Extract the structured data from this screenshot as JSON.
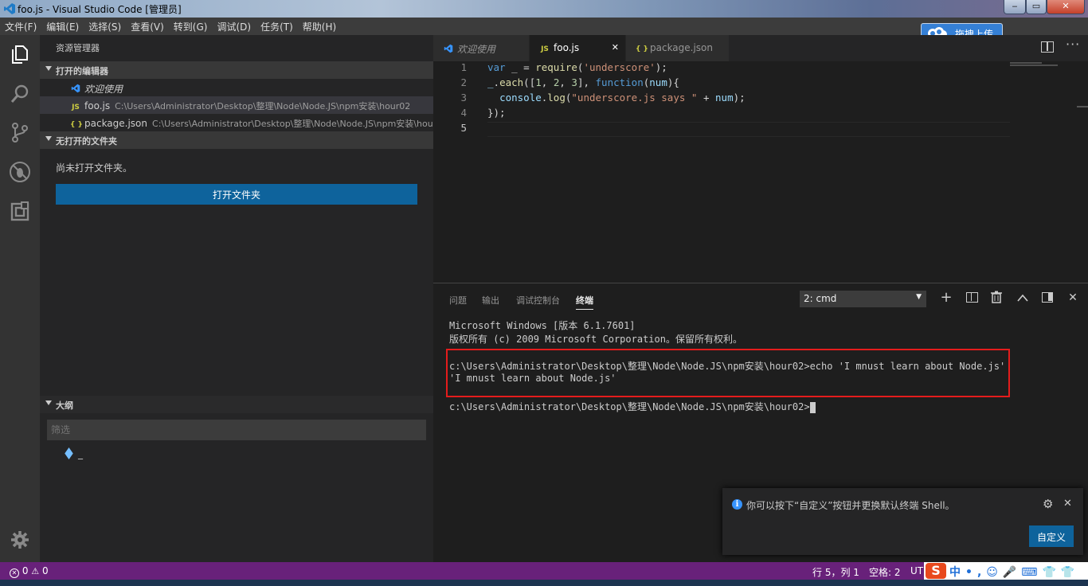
{
  "window": {
    "title": "foo.js - Visual Studio Code [管理员]",
    "controls": {
      "minimize": "‒",
      "restore": "▭",
      "close": "✕"
    }
  },
  "menu": [
    "文件(F)",
    "编辑(E)",
    "选择(S)",
    "查看(V)",
    "转到(G)",
    "调试(D)",
    "任务(T)",
    "帮助(H)"
  ],
  "upload_button": {
    "label": "拖拽上传"
  },
  "activity_bar": {
    "items": [
      "files-icon",
      "search-icon",
      "source-control-icon",
      "debug-icon",
      "extensions-icon"
    ],
    "bottom": "gear-icon"
  },
  "sidebar": {
    "title": "资源管理器",
    "open_editors": {
      "header": "打开的编辑器",
      "items": [
        {
          "icon": "vscode-icon",
          "name": "欢迎使用",
          "path": ""
        },
        {
          "icon": "js-icon",
          "icon_text": "JS",
          "name": "foo.js",
          "path": "C:\\Users\\Administrator\\Desktop\\整理\\Node\\Node.JS\\npm安装\\hour02"
        },
        {
          "icon": "json-icon",
          "icon_text": "{ }",
          "name": "package.json",
          "path": "C:\\Users\\Administrator\\Desktop\\整理\\Node\\Node.JS\\npm安装\\hou..."
        }
      ]
    },
    "no_folder": {
      "header": "无打开的文件夹",
      "message": "尚未打开文件夹。",
      "button": "打开文件夹"
    },
    "outline": {
      "header": "大纲",
      "filter_placeholder": "筛选",
      "item": "_"
    }
  },
  "tabs": [
    {
      "label": "欢迎使用",
      "icon_text": ""
    },
    {
      "label": "foo.js",
      "icon_text": "JS",
      "close": "✕"
    },
    {
      "label": "package.json",
      "icon_text": "{ }"
    }
  ],
  "editor": {
    "line_numbers": [
      "1",
      "2",
      "3",
      "4",
      "5"
    ],
    "lines": [
      [
        {
          "t": "var",
          "c": "kw"
        },
        {
          "t": " _ = ",
          "c": ""
        },
        {
          "t": "require",
          "c": "fn"
        },
        {
          "t": "(",
          "c": ""
        },
        {
          "t": "'underscore'",
          "c": "str"
        },
        {
          "t": ");",
          "c": ""
        }
      ],
      [
        {
          "t": "_",
          "c": "var"
        },
        {
          "t": ".",
          "c": ""
        },
        {
          "t": "each",
          "c": "fn"
        },
        {
          "t": "([",
          "c": ""
        },
        {
          "t": "1",
          "c": "num"
        },
        {
          "t": ", ",
          "c": ""
        },
        {
          "t": "2",
          "c": "num"
        },
        {
          "t": ", ",
          "c": ""
        },
        {
          "t": "3",
          "c": "num"
        },
        {
          "t": "], ",
          "c": ""
        },
        {
          "t": "function",
          "c": "kw"
        },
        {
          "t": "(",
          "c": ""
        },
        {
          "t": "num",
          "c": "var"
        },
        {
          "t": "){",
          "c": ""
        }
      ],
      [
        {
          "t": "  ",
          "c": ""
        },
        {
          "t": "console",
          "c": "var"
        },
        {
          "t": ".",
          "c": ""
        },
        {
          "t": "log",
          "c": "fn"
        },
        {
          "t": "(",
          "c": ""
        },
        {
          "t": "\"underscore.js says \"",
          "c": "str"
        },
        {
          "t": " + ",
          "c": ""
        },
        {
          "t": "num",
          "c": "var"
        },
        {
          "t": ");",
          "c": ""
        }
      ],
      [
        {
          "t": "});",
          "c": ""
        }
      ],
      []
    ]
  },
  "panel": {
    "tabs": [
      "问题",
      "输出",
      "调试控制台",
      "终端"
    ],
    "active_tab": "终端",
    "terminal_select": "2: cmd",
    "actions": [
      "plus-icon",
      "split-icon",
      "trash-icon",
      "chevron-up-icon",
      "layout-icon",
      "close-icon"
    ],
    "terminal_lines": [
      "Microsoft Windows [版本 6.1.7601]",
      "版权所有 (c) 2009 Microsoft Corporation。保留所有权利。",
      "",
      "c:\\Users\\Administrator\\Desktop\\整理\\Node\\Node.JS\\npm安装\\hour02>echo 'I mnust learn about Node.js'",
      "'I mnust learn about Node.js'",
      "",
      "c:\\Users\\Administrator\\Desktop\\整理\\Node\\Node.JS\\npm安装\\hour02>"
    ]
  },
  "notification": {
    "message": "你可以按下“自定义”按钮并更换默认终端 Shell。",
    "button": "自定义"
  },
  "status_bar": {
    "errors": "0",
    "warnings": "0",
    "position": "行 5，列 1",
    "spaces": "空格: 2",
    "encoding": "UTF"
  },
  "colors": {
    "status_bar": "#68217a",
    "accent": "#0e639c",
    "redbox": "#e41c1c"
  }
}
